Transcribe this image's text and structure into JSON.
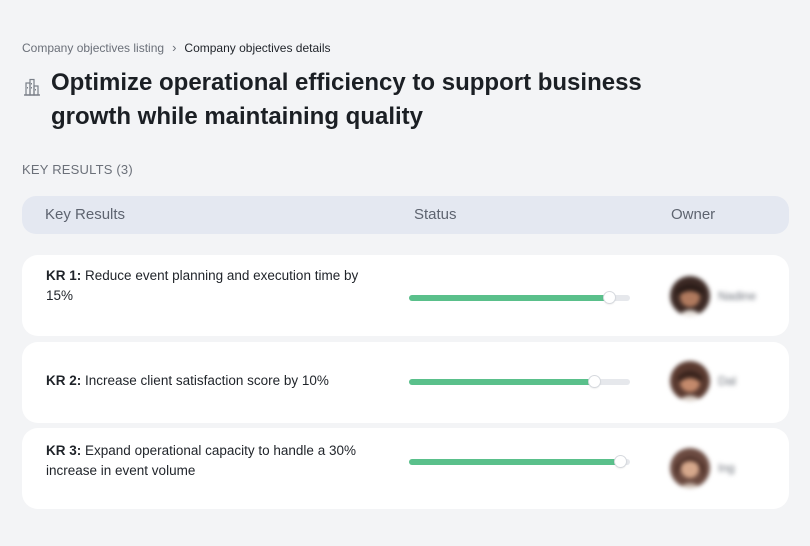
{
  "breadcrumb": {
    "parent": "Company objectives listing",
    "separator": "›",
    "current": "Company objectives details"
  },
  "objective": {
    "icon": "building-chart-icon",
    "title": "Optimize operational efficiency to support business growth while maintaining quality"
  },
  "key_results_section": {
    "label": "KEY RESULTS (3)"
  },
  "table": {
    "columns": [
      "Key Results",
      "Status",
      "Owner"
    ]
  },
  "key_results": [
    {
      "id": "KR 1:",
      "text": "Reduce event planning and execution time by 15%",
      "progress": 0.91,
      "owner": "Nadine"
    },
    {
      "id": "KR 2:",
      "text": "Increase client satisfaction score by 10%",
      "progress": 0.84,
      "owner": "Dal"
    },
    {
      "id": "KR 3:",
      "text": "Expand operational capacity to handle a 30% increase in event volume",
      "progress": 0.96,
      "owner": "Ing"
    }
  ],
  "colors": {
    "background": "#f3f4f6",
    "header_bg": "#e4e8f1",
    "progress_fill": "#5ac08b",
    "progress_track": "#e6e8ec"
  }
}
